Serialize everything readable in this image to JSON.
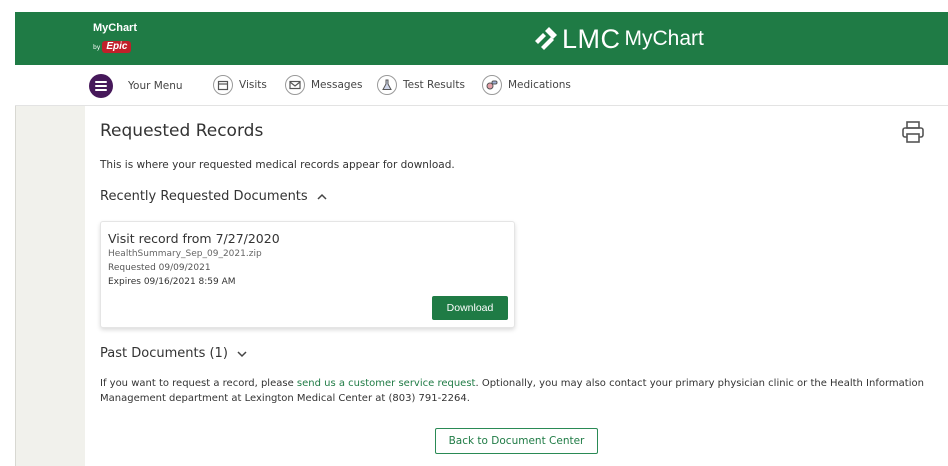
{
  "header": {
    "small_brand": {
      "name": "MyChart",
      "by": "by",
      "vendor": "Epic"
    },
    "main_brand": {
      "org": "LMC",
      "product": "MyChart"
    },
    "color": "#1f7b45"
  },
  "nav": {
    "menu_label": "Your Menu",
    "items": [
      {
        "label": "Visits",
        "icon": "calendar-icon"
      },
      {
        "label": "Messages",
        "icon": "envelope-icon"
      },
      {
        "label": "Test Results",
        "icon": "flask-icon"
      },
      {
        "label": "Medications",
        "icon": "pills-icon"
      }
    ]
  },
  "page": {
    "title": "Requested Records",
    "intro": "This is where your requested medical records appear for download.",
    "recent_heading": "Recently Requested Documents",
    "past_heading": "Past Documents (1)"
  },
  "record": {
    "title": "Visit record from 7/27/2020",
    "file": "HealthSummary_Sep_09_2021.zip",
    "requested": "Requested 09/09/2021",
    "expires": "Expires 09/16/2021 8:59 AM",
    "download_label": "Download"
  },
  "info": {
    "before_link": "If you want to request a record, please ",
    "link": "send us a customer service request",
    "after_link": ". Optionally, you may also contact your primary physician clinic or the Health Information Management department at Lexington Medical Center at (803) 791-2264."
  },
  "back_button": "Back to Document Center"
}
